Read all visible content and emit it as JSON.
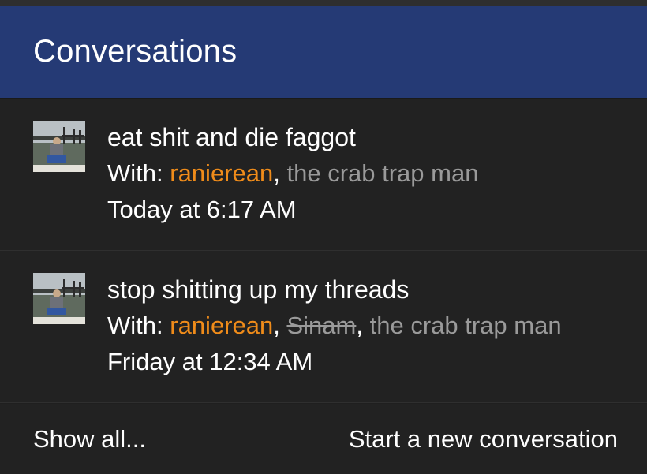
{
  "header": {
    "title": "Conversations"
  },
  "conversations": [
    {
      "title": "eat shit and die faggot",
      "with_label": "With:",
      "participants": [
        {
          "name": "ranierean",
          "style": "highlight"
        },
        {
          "name": "the crab trap man",
          "style": "muted"
        }
      ],
      "time": "Today at 6:17 AM",
      "avatar_icon": "user-avatar-photo"
    },
    {
      "title": "stop shitting up my threads",
      "with_label": "With:",
      "participants": [
        {
          "name": "ranierean",
          "style": "highlight"
        },
        {
          "name": "Sinam",
          "style": "struck"
        },
        {
          "name": "the crab trap man",
          "style": "muted"
        }
      ],
      "time": "Friday at 12:34 AM",
      "avatar_icon": "user-avatar-photo"
    }
  ],
  "footer": {
    "show_all": "Show all...",
    "new_conversation": "Start a new conversation"
  },
  "colors": {
    "header_bg": "#253a75",
    "highlight": "#f08c1a",
    "muted": "#9a9a9a",
    "background": "#222222"
  }
}
